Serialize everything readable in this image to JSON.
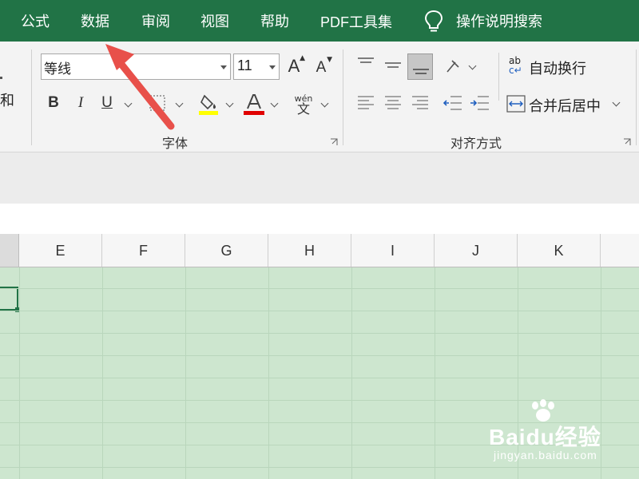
{
  "ribbon_tabs": {
    "formulas": "公式",
    "data": "数据",
    "review": "审阅",
    "view": "视图",
    "help": "帮助",
    "pdf_tools": "PDF工具集",
    "tell_me": "操作说明搜索"
  },
  "left_cut_label": "和",
  "font_group": {
    "font_name": "等线",
    "font_size": "11",
    "grow_font": "A",
    "shrink_font": "A",
    "bold": "B",
    "italic": "I",
    "underline": "U",
    "phonetic_top": "wén",
    "phonetic_bottom": "文",
    "label": "字体",
    "fill_color": "#ffff00",
    "font_color": "#e00000"
  },
  "alignment_group": {
    "wrap_text": "自动换行",
    "merge_center": "合并后居中",
    "wrap_icon_text": "ab",
    "label": "对齐方式"
  },
  "columns": [
    "E",
    "F",
    "G",
    "H",
    "I",
    "J",
    "K"
  ],
  "watermark": {
    "title": "Baidu经验",
    "url": "jingyan.baidu.com"
  },
  "colors": {
    "accent": "#217346",
    "grid_bg": "#cde6cf",
    "arrow": "#e8504a"
  }
}
